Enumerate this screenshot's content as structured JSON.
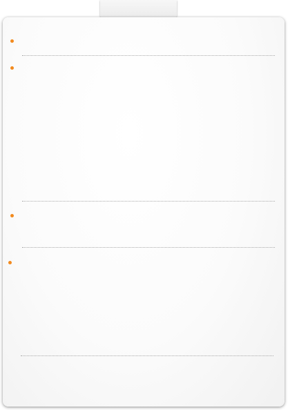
{
  "theme": {
    "accent": "#f28a1e",
    "divider": "#a9a9a9",
    "card_bg": "#fbfbfb"
  },
  "sections": [
    {
      "id": "item-1",
      "text": ""
    },
    {
      "id": "item-2",
      "text": ""
    },
    {
      "id": "item-3",
      "text": ""
    },
    {
      "id": "item-4",
      "text": ""
    }
  ]
}
